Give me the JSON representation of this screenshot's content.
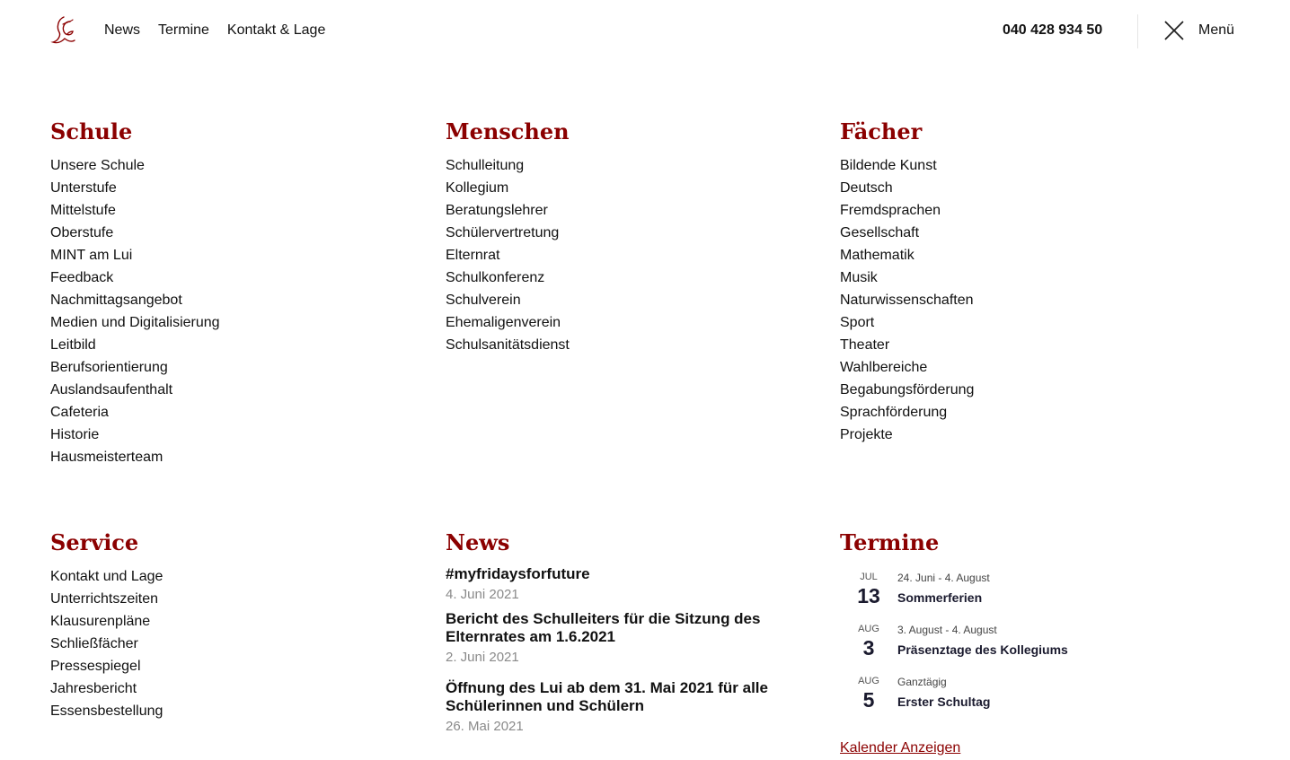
{
  "header": {
    "logo_icon": "lg-monogram-icon",
    "nav": [
      "News",
      "Termine",
      "Kontakt & Lage"
    ],
    "phone": "040 428 934 50",
    "menu_icon": "close-icon",
    "menu_label": "Menü"
  },
  "colors": {
    "accent": "#8b0000",
    "text": "#111111",
    "muted": "#8a8a8a"
  },
  "sections": {
    "schule": {
      "heading": "Schule",
      "links": [
        "Unsere Schule",
        "Unterstufe",
        "Mittelstufe",
        "Oberstufe",
        "MINT am Lui",
        "Feedback",
        "Nachmittagsangebot",
        "Medien und Digitalisierung",
        "Leitbild",
        "Berufsorientierung",
        "Auslandsaufenthalt",
        "Cafeteria",
        "Historie",
        "Hausmeisterteam"
      ]
    },
    "menschen": {
      "heading": "Menschen",
      "links": [
        "Schulleitung",
        "Kollegium",
        "Beratungslehrer",
        "Schülervertretung",
        "Elternrat",
        "Schulkonferenz",
        "Schulverein",
        "Ehemaligenverein",
        "Schulsanitätsdienst"
      ]
    },
    "faecher": {
      "heading": "Fächer",
      "links": [
        "Bildende Kunst",
        "Deutsch",
        "Fremdsprachen",
        "Gesellschaft",
        "Mathematik",
        "Musik",
        "Naturwissenschaften",
        "Sport",
        "Theater",
        "Wahlbereiche",
        "Begabungsförderung",
        "Sprachförderung",
        "Projekte"
      ]
    },
    "service": {
      "heading": "Service",
      "links": [
        "Kontakt und Lage",
        "Unterrichtszeiten",
        "Klausurenpläne",
        "Schließfächer",
        "Pressespiegel",
        "Jahresbericht",
        "Essensbestellung"
      ]
    },
    "news": {
      "heading": "News",
      "items": [
        {
          "title": "#myfridaysforfuture",
          "date": "4. Juni 2021"
        },
        {
          "title": "Bericht des Schulleiters für die Sitzung des Elternrates am 1.6.2021",
          "date": "2. Juni 2021"
        },
        {
          "title": "Öffnung des Lui ab dem 31. Mai 2021 für alle Schülerinnen und Schülern",
          "date": "26. Mai 2021"
        }
      ]
    },
    "termine": {
      "heading": "Termine",
      "events": [
        {
          "month": "JUL",
          "day": "13",
          "range": "24. Juni - 4. August",
          "title": "Sommerferien"
        },
        {
          "month": "AUG",
          "day": "3",
          "range": "3. August - 4. August",
          "title": "Präsenztage des Kollegiums"
        },
        {
          "month": "AUG",
          "day": "5",
          "range": "Ganztägig",
          "title": "Erster Schultag"
        }
      ],
      "calendar_link": "Kalender Anzeigen"
    }
  }
}
